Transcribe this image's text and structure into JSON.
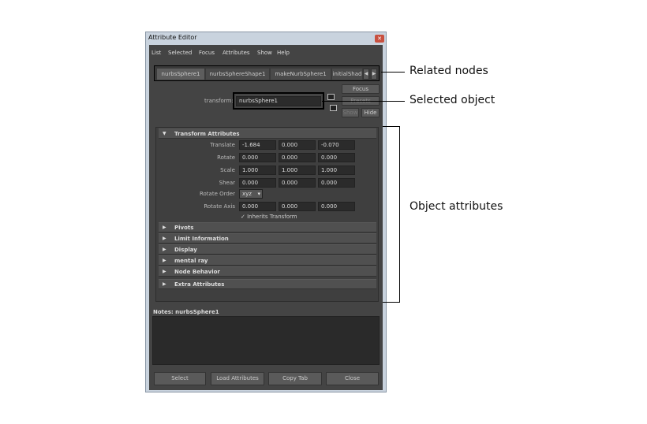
{
  "window": {
    "title": "Attribute Editor"
  },
  "menu": [
    "List",
    "Selected",
    "Focus",
    "Attributes",
    "Show",
    "Help"
  ],
  "tabs": [
    "nurbsSphere1",
    "nurbsSphereShape1",
    "makeNurbSphere1",
    "initialShad"
  ],
  "transform": {
    "label": "transform:",
    "value": "nurbsSphere1"
  },
  "side_buttons": {
    "focus": "Focus",
    "presets": "Presets",
    "show": "Show",
    "hide": "Hide"
  },
  "transform_attributes": {
    "title": "Transform Attributes",
    "rows": [
      {
        "label": "Translate",
        "values": [
          "-1.684",
          "0.000",
          "-0.070"
        ]
      },
      {
        "label": "Rotate",
        "values": [
          "0.000",
          "0.000",
          "0.000"
        ]
      },
      {
        "label": "Scale",
        "values": [
          "1.000",
          "1.000",
          "1.000"
        ]
      },
      {
        "label": "Shear",
        "values": [
          "0.000",
          "0.000",
          "0.000"
        ]
      }
    ],
    "rotate_order": {
      "label": "Rotate Order",
      "value": "xyz"
    },
    "rotate_axis": {
      "label": "Rotate Axis",
      "values": [
        "0.000",
        "0.000",
        "0.000"
      ]
    },
    "inherits": {
      "label": "Inherits Transform",
      "checked": true
    }
  },
  "sections": [
    "Pivots",
    "Limit Information",
    "Display",
    "mental ray",
    "Node Behavior",
    "Extra Attributes"
  ],
  "notes": {
    "label": "Notes:  nurbsSphere1"
  },
  "bottom_buttons": [
    "Select",
    "Load Attributes",
    "Copy Tab",
    "Close"
  ],
  "annotations": {
    "related": "Related nodes",
    "selected": "Selected object",
    "attributes": "Object attributes"
  }
}
